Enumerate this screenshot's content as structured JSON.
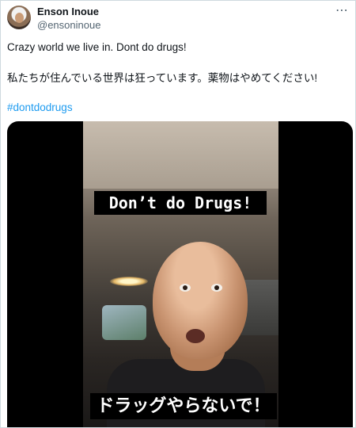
{
  "tweet": {
    "display_name": "Enson Inoue",
    "handle": "@ensoninoue",
    "more_icon": "more-horizontal-icon",
    "text_line1": "Crazy world we live in. Dont do drugs!",
    "text_line2": "私たちが住んでいる世界は狂っています。薬物はやめてください!",
    "hashtag": "#dontdodrugs"
  },
  "video": {
    "caption_top": "Don’t do Drugs!",
    "caption_bottom": "ドラッグやらないで！"
  },
  "colors": {
    "link": "#1d9bf0",
    "text": "#0f1419",
    "muted": "#536471",
    "border": "#cfd9de"
  }
}
